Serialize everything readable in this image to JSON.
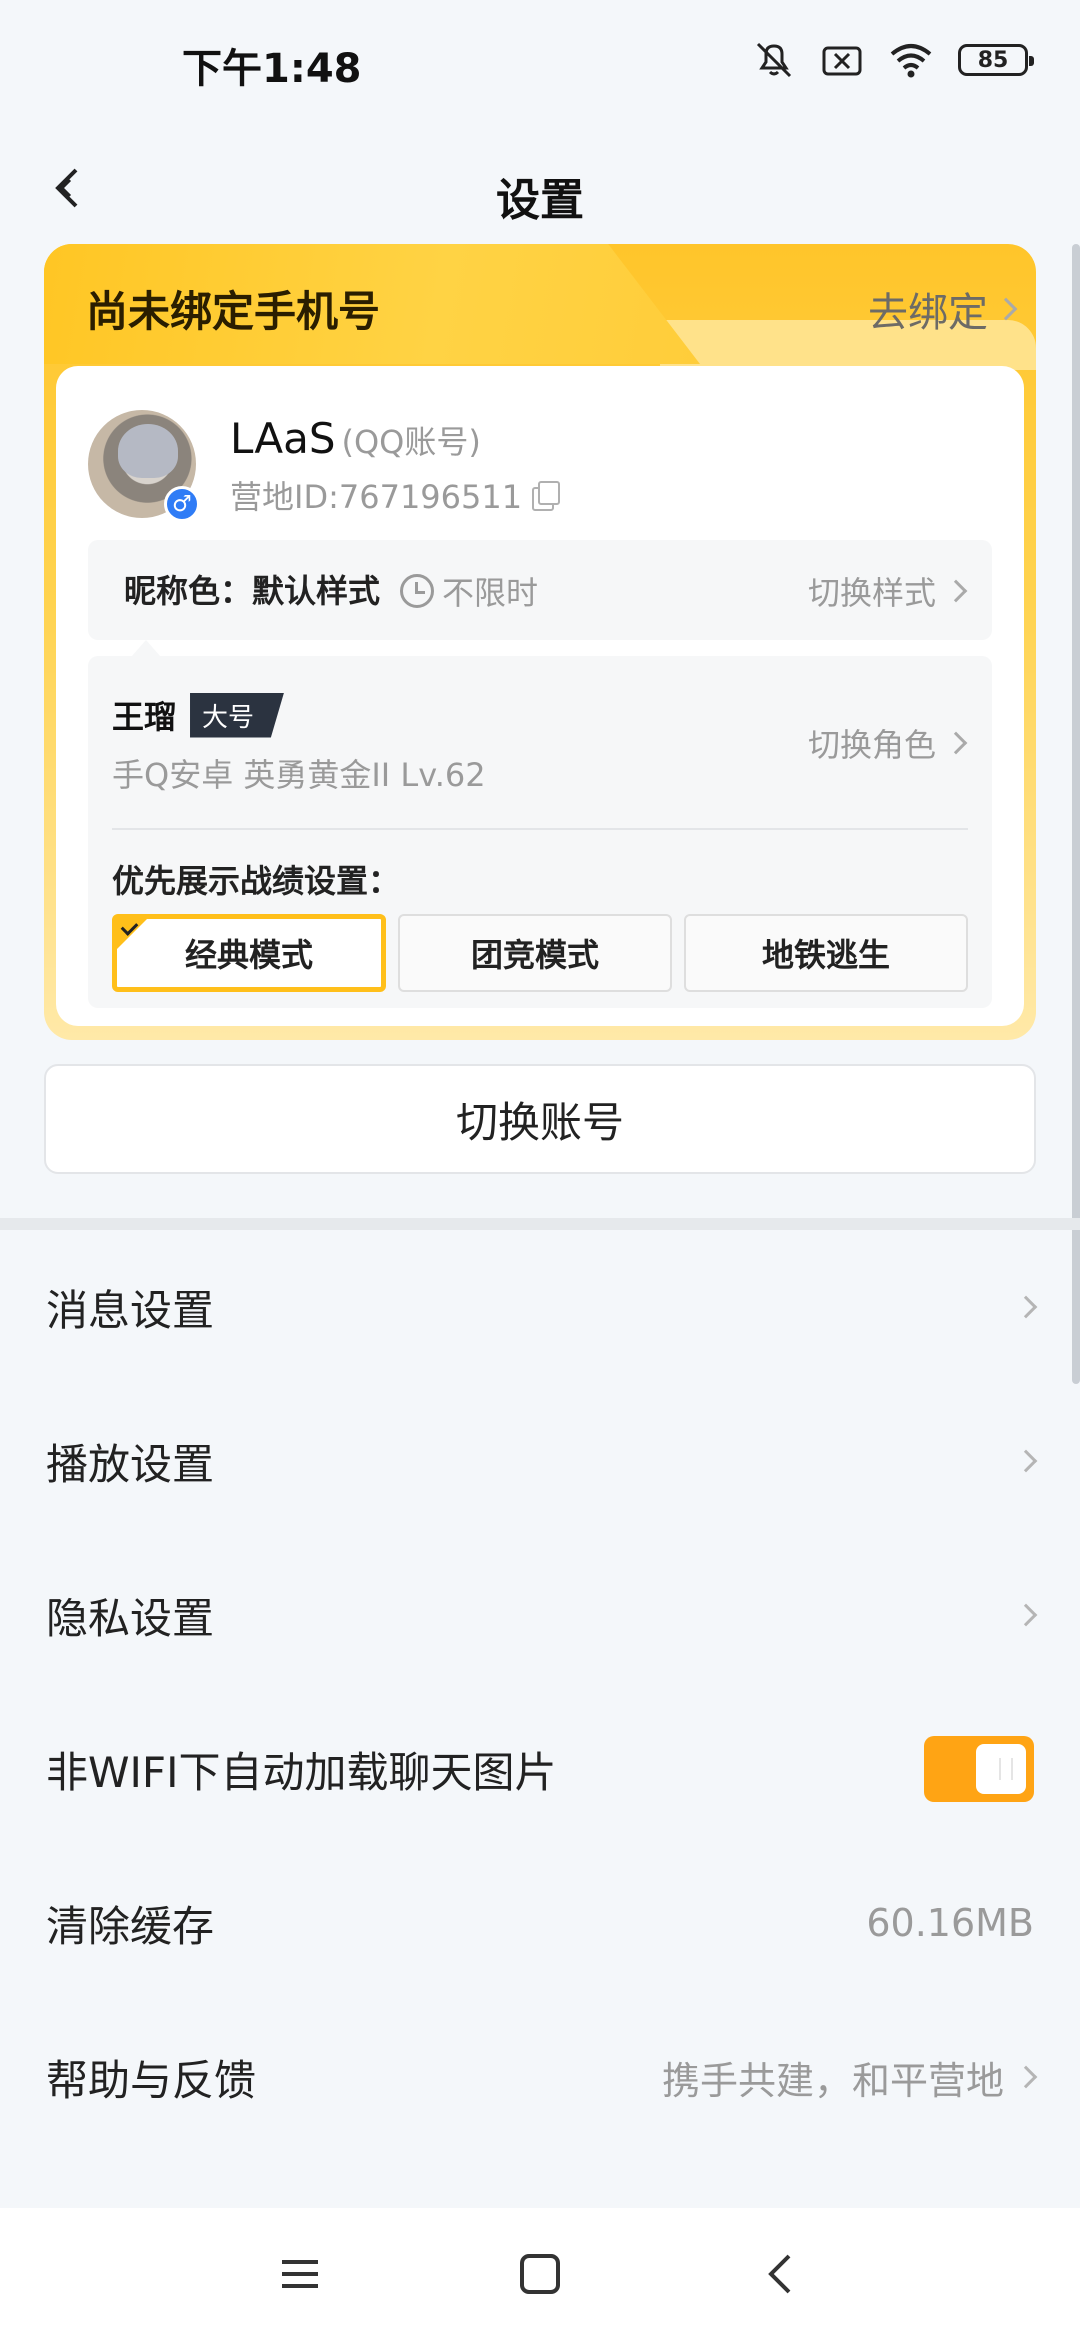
{
  "status_bar": {
    "time": "下午1:48",
    "battery": "85",
    "icons": [
      "mute-icon",
      "no-sim-icon",
      "wifi-icon",
      "battery-icon"
    ]
  },
  "header": {
    "title": "设置",
    "back_icon": "back-arrow-icon"
  },
  "account_card": {
    "bind_title": "尚未绑定手机号",
    "bind_link": "去绑定",
    "nickname": "LAaS",
    "account_type": "(QQ账号)",
    "camp_id": "营地ID:767196511",
    "nick_color_label": "昵称色：默认样式",
    "nick_color_duration": "不限时",
    "nick_color_switch": "切换样式",
    "role": {
      "name": "王瑠",
      "badge": "大号",
      "info": "手Q安卓  英勇黄金II  Lv.62",
      "switch_label": "切换角色"
    },
    "pref_label": "优先展示战绩设置：",
    "modes": [
      {
        "label": "经典模式",
        "selected": true
      },
      {
        "label": "团竞模式",
        "selected": false
      },
      {
        "label": "地铁逃生",
        "selected": false
      }
    ]
  },
  "switch_account": "切换账号",
  "settings": [
    {
      "label": "消息设置",
      "type": "link"
    },
    {
      "label": "播放设置",
      "type": "link"
    },
    {
      "label": "隐私设置",
      "type": "link"
    },
    {
      "label": "非WIFI下自动加载聊天图片",
      "type": "toggle",
      "on": true
    },
    {
      "label": "清除缓存",
      "type": "value",
      "value": "60.16MB"
    },
    {
      "label": "帮助与反馈",
      "type": "link",
      "value": "携手共建，和平营地"
    }
  ],
  "colors": {
    "accent": "#ffa414",
    "card_gold": "#ffc52a",
    "background": "#f4f7fa"
  }
}
